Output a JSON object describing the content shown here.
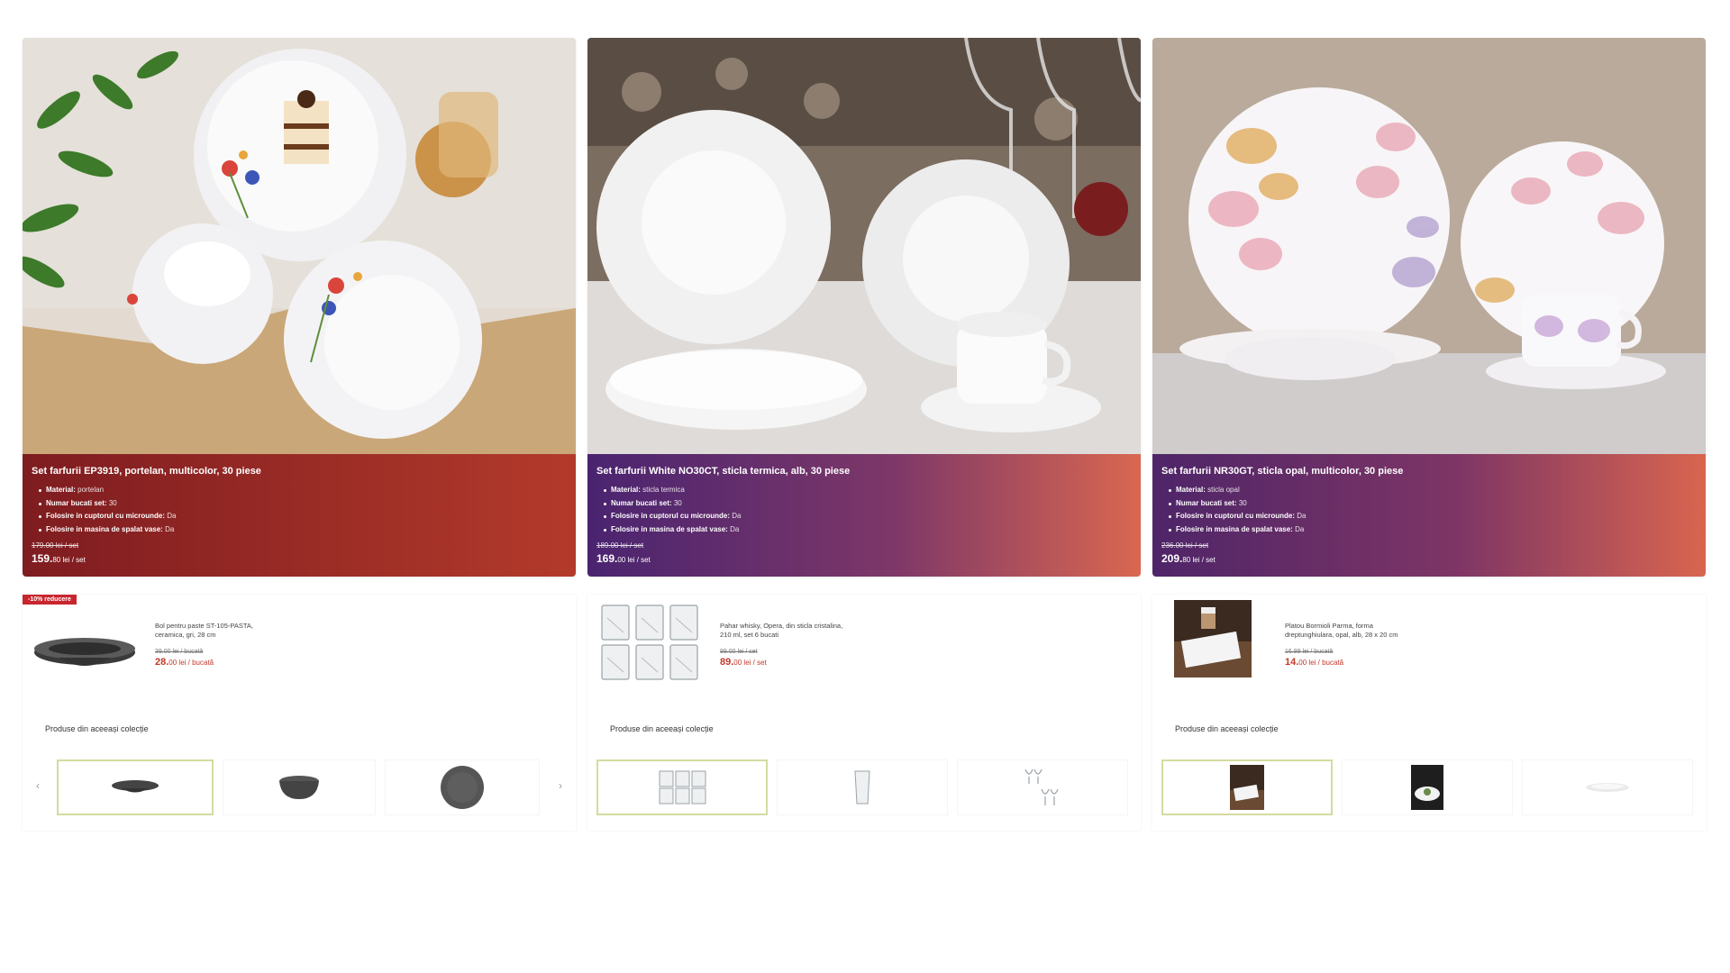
{
  "cards": [
    {
      "title": "Set farfurii EP3919, portelan, multicolor, 30 piese",
      "specs": [
        {
          "label": "Material:",
          "value": "portelan"
        },
        {
          "label": "Numar bucati set:",
          "value": "30"
        },
        {
          "label": "Folosire in cuptorul cu microunde:",
          "value": "Da"
        },
        {
          "label": "Folosire in masina de spalat vase:",
          "value": "Da"
        }
      ],
      "old_price": "179.00 lei / set",
      "price_main": "159.",
      "price_sub": "80 lei / set",
      "badge": "-10% reducere",
      "product": {
        "name": "Bol pentru paste ST-105-PASTA, ceramica, gri, 28 cm",
        "old_price": "39.00 lei / bucată",
        "price_main": "28.",
        "price_sub": "00 lei / bucată"
      },
      "collection_title": "Produse din aceeași colecție",
      "arrow_left": "‹",
      "arrow_right": "›"
    },
    {
      "title": "Set farfurii White NO30CT, sticla termica, alb, 30 piese",
      "specs": [
        {
          "label": "Material:",
          "value": "sticla termica"
        },
        {
          "label": "Numar bucati set:",
          "value": "30"
        },
        {
          "label": "Folosire in cuptorul cu microunde:",
          "value": "Da"
        },
        {
          "label": "Folosire in masina de spalat vase:",
          "value": "Da"
        }
      ],
      "old_price": "189.00 lei / set",
      "price_main": "169.",
      "price_sub": "00 lei / set",
      "product": {
        "name": "Pahar whisky, Opera, din sticla cristalina, 210 ml, set 6 bucati",
        "old_price": "99.00 lei / set",
        "price_main": "89.",
        "price_sub": "00 lei / set"
      },
      "collection_title": "Produse din aceeași colecție"
    },
    {
      "title": "Set farfurii NR30GT, sticla opal, multicolor, 30 piese",
      "specs": [
        {
          "label": "Material:",
          "value": "sticla opal"
        },
        {
          "label": "Numar bucati set:",
          "value": "30"
        },
        {
          "label": "Folosire in cuptorul cu microunde:",
          "value": "Da"
        },
        {
          "label": "Folosire in masina de spalat vase:",
          "value": "Da"
        }
      ],
      "old_price": "236.00 lei / set",
      "price_main": "209.",
      "price_sub": "80 lei / set",
      "product": {
        "name": "Platou Bormioli Parma, forma dreptunghiulara, opal, alb, 28 x 20 cm",
        "old_price": "16.99 lei / bucată",
        "price_main": "14.",
        "price_sub": "00 lei / bucată"
      },
      "collection_title": "Produse din aceeași colecție"
    }
  ]
}
